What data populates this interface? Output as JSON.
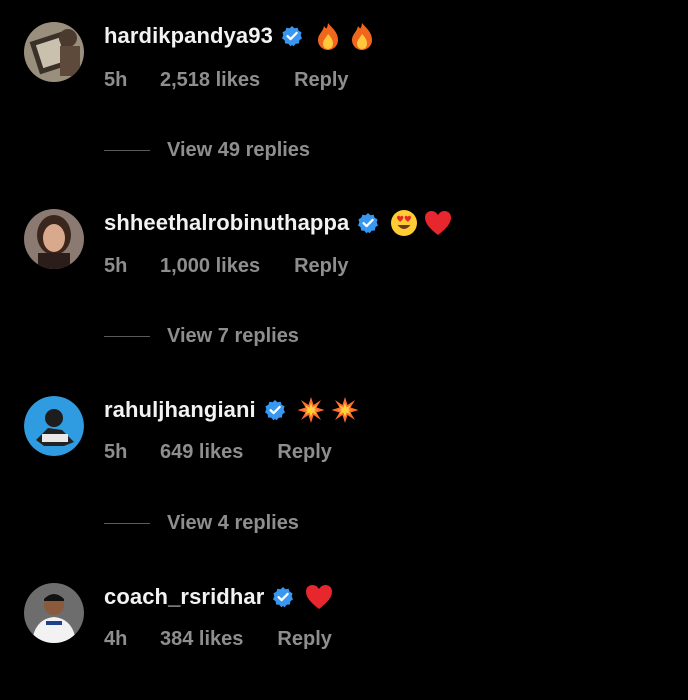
{
  "comments": [
    {
      "username": "hardikpandya93",
      "time": "5h",
      "likes": "2,518 likes",
      "reply": "Reply",
      "view_replies": "View 49 replies",
      "emojis": [
        "fire-emoji",
        "fire-emoji"
      ]
    },
    {
      "username": "shheethalrobinuthappa",
      "time": "5h",
      "likes": "1,000 likes",
      "reply": "Reply",
      "view_replies": "View 7 replies",
      "emojis": [
        "heart-eyes-emoji",
        "red-heart-emoji"
      ]
    },
    {
      "username": "rahuljhangiani",
      "time": "5h",
      "likes": "649 likes",
      "reply": "Reply",
      "view_replies": "View 4 replies",
      "emojis": [
        "collision-emoji",
        "collision-emoji"
      ]
    },
    {
      "username": "coach_rsridhar",
      "time": "4h",
      "likes": "384 likes",
      "reply": "Reply",
      "emojis": [
        "red-heart-emoji"
      ]
    }
  ],
  "colors": {
    "background": "#000000",
    "username": "#f2f2f2",
    "meta": "#8e8e8e",
    "verified": "#3897f0"
  }
}
